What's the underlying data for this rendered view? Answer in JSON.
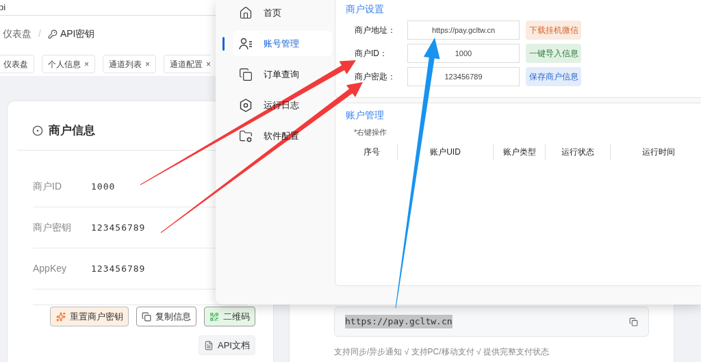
{
  "browser": {
    "address": "pi"
  },
  "breadcrumb": {
    "items": [
      "仪表盘",
      "API密钥"
    ],
    "separator": "/"
  },
  "tabs": [
    {
      "label": "仪表盘"
    },
    {
      "label": "个人信息",
      "close": "×"
    },
    {
      "label": "通道列表",
      "close": "×"
    },
    {
      "label": "通道配置",
      "close": "×"
    }
  ],
  "merchant_card": {
    "title": "商户信息",
    "fields": [
      {
        "label": "商户ID",
        "value": "1000"
      },
      {
        "label": "商户密钥",
        "value": "123456789"
      },
      {
        "label": "AppKey",
        "value": "123456789"
      }
    ],
    "buttons": [
      {
        "label": "重置商户密钥",
        "kind": "reset"
      },
      {
        "label": "复制信息",
        "kind": "copy"
      },
      {
        "label": "二维码",
        "kind": "qr"
      },
      {
        "label": "API文档",
        "kind": "docs"
      }
    ]
  },
  "gateway_card": {
    "url": "https://pay.gcltw.cn",
    "note": "支持同步/异步通知 √ 支持PC/移动支付 √ 提供完整支付状态"
  },
  "app": {
    "nav": [
      {
        "label": "首页",
        "selected": false
      },
      {
        "label": "账号管理",
        "selected": true
      },
      {
        "label": "订单查询",
        "selected": false
      },
      {
        "label": "运行日志",
        "selected": false
      },
      {
        "label": "软件配置",
        "selected": false
      }
    ],
    "merchant_settings": {
      "title": "商户设置",
      "rows": [
        {
          "label": "商户地址：",
          "value": "https://pay.gcltw.cn",
          "action": "下载挂机微信",
          "kind": "download"
        },
        {
          "label": "商户ID：",
          "value": "1000",
          "action": "一键导入信息",
          "kind": "import"
        },
        {
          "label": "商户密匙：",
          "value": "123456789",
          "action": "保存商户信息",
          "kind": "save"
        }
      ]
    },
    "accounts": {
      "title": "账户管理",
      "hint": "*右键操作",
      "columns": [
        "序号",
        "账户UID",
        "账户类型",
        "运行状态",
        "运行时间"
      ]
    }
  }
}
